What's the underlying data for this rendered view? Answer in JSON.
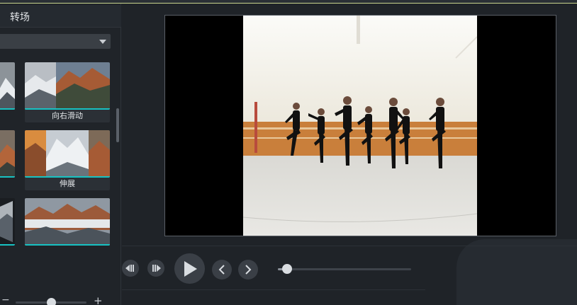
{
  "panel": {
    "title": "转场",
    "dropdown_value": ""
  },
  "transitions": [
    {
      "label": "",
      "thumb": "mountain-fog-left"
    },
    {
      "label": "向右滑动",
      "thumb": "slide-right"
    },
    {
      "label": "",
      "thumb": "mountain-left-2"
    },
    {
      "label": "伸展",
      "thumb": "stretch"
    },
    {
      "label": "",
      "thumb": "cube-left"
    },
    {
      "label": "",
      "thumb": "mountain-shatter"
    }
  ],
  "zoom": {
    "minus": "−",
    "plus": "+",
    "level": 0.45
  },
  "player": {
    "progress": 0.07,
    "buttons": [
      "previous-frame",
      "next-frame",
      "play",
      "previous",
      "next"
    ]
  },
  "colors": {
    "accent": "#17c2c2",
    "background": "#1f2328"
  }
}
